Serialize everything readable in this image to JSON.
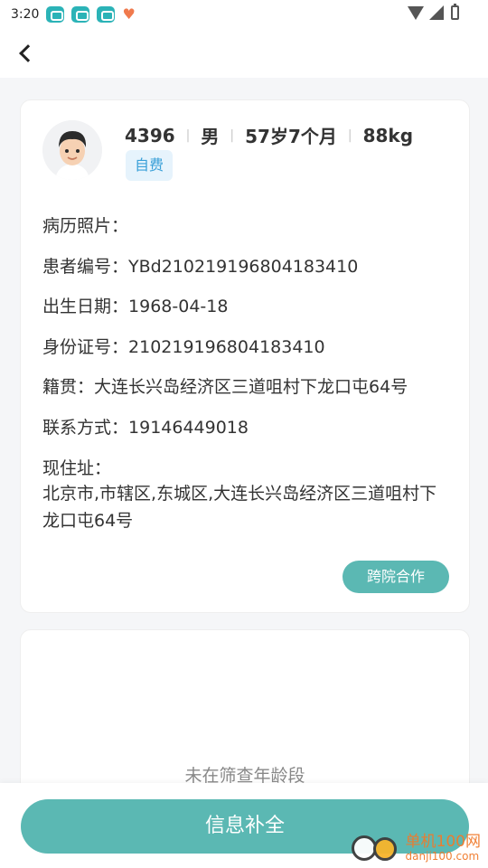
{
  "status_bar": {
    "time": "3:20",
    "apps": [
      "app-icon",
      "app-icon",
      "app-icon"
    ],
    "heart": "♥"
  },
  "header": {
    "back_icon": "chevron-left-icon"
  },
  "patient": {
    "name": "4396",
    "gender": "男",
    "age": "57岁7个月",
    "weight": "88kg",
    "payment_badge": "自费",
    "fields": {
      "photos_label": "病历照片：",
      "patient_no_label": "患者编号：",
      "patient_no_value": "YBd210219196804183410",
      "birth_label": "出生日期：",
      "birth_value": "1968-04-18",
      "id_label": "身份证号：",
      "id_value": "210219196804183410",
      "native_label": "籍贯：",
      "native_value": "大连长兴岛经济区三道咀村下龙口屯64号",
      "contact_label": "联系方式：",
      "contact_value": "19146449018",
      "address_label": "现住址：",
      "address_value": "北京市,市辖区,东城区,大连长兴岛经济区三道咀村下龙口屯64号"
    },
    "coop_button": "跨院合作"
  },
  "screening": {
    "message": "未在筛查年龄段"
  },
  "bottom": {
    "submit_button": "信息补全"
  },
  "watermark": {
    "title": "单机100网",
    "url": "danji100.com"
  }
}
